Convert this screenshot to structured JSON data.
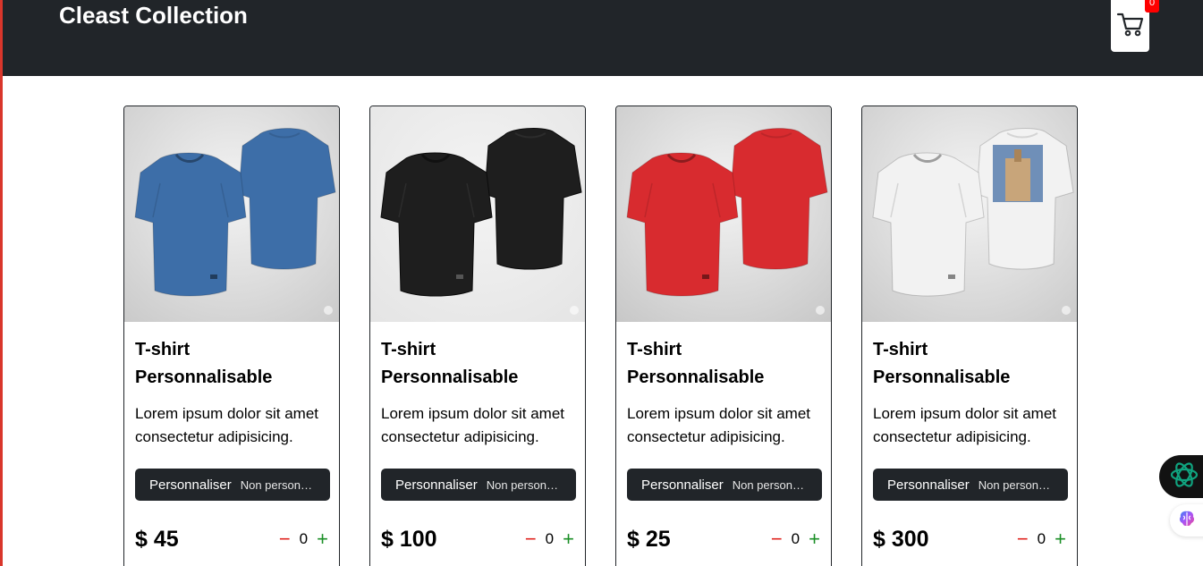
{
  "header": {
    "title": "Cleast Collection",
    "cart_count": "0",
    "background": "#212529"
  },
  "products": [
    {
      "title_line1": "T-shirt",
      "title_line2": "Personnalisable",
      "description": "Lorem ipsum dolor sit amet consectetur adipisicing.",
      "button_label": "Personnaliser",
      "button_status": "Non personnalisé",
      "price": "$ 45",
      "quantity": "0",
      "shirt_color": "#3d6ea8",
      "image_bg": "#c9c9c9"
    },
    {
      "title_line1": "T-shirt",
      "title_line2": "Personnalisable",
      "description": "Lorem ipsum dolor sit amet consectetur adipisicing.",
      "button_label": "Personnaliser",
      "button_status": "Non personnalisé",
      "price": "$ 100",
      "quantity": "0",
      "shirt_color": "#1e1e1e",
      "image_bg": "#e4e4e4"
    },
    {
      "title_line1": "T-shirt",
      "title_line2": "Personnalisable",
      "description": "Lorem ipsum dolor sit amet consectetur adipisicing.",
      "button_label": "Personnaliser",
      "button_status": "Non personnalisé",
      "price": "$ 25",
      "quantity": "0",
      "shirt_color": "#d82b2f",
      "image_bg": "#c6c6c6"
    },
    {
      "title_line1": "T-shirt",
      "title_line2": "Personnalisable",
      "description": "Lorem ipsum dolor sit amet consectetur adipisicing.",
      "button_label": "Personnaliser",
      "button_status": "Non personnalisé",
      "price": "$ 300",
      "quantity": "0",
      "shirt_color": "#f2f2f2",
      "image_bg": "#c9c9c9"
    }
  ],
  "colors": {
    "minus": "#e0201b",
    "plus": "#1b8f26",
    "badge": "#ff0000",
    "accent_border": "#d9362b"
  },
  "icons": {
    "cart": "cart-icon",
    "chat": "chatgpt-icon",
    "brain": "brain-icon"
  }
}
